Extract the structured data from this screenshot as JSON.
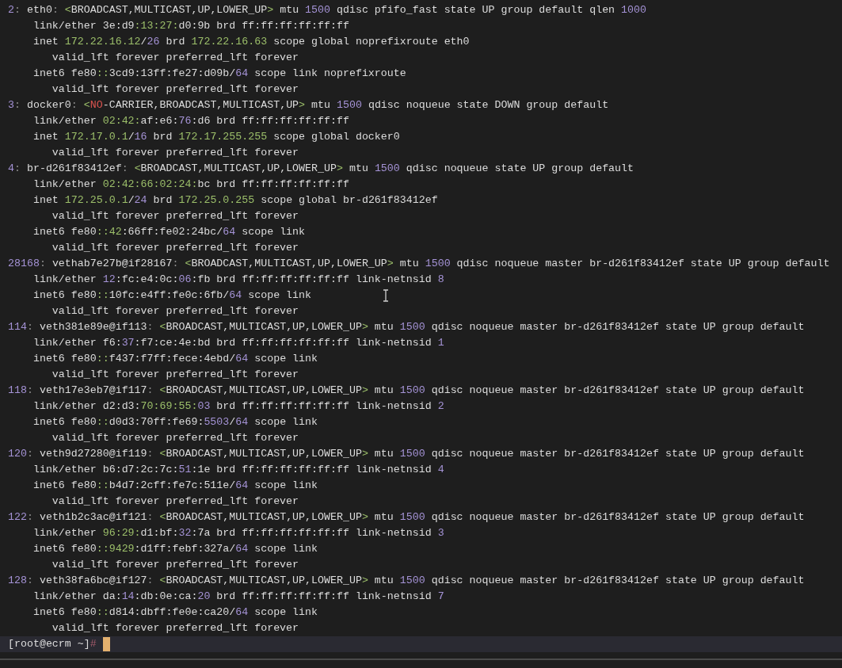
{
  "terminal": {
    "lines": [
      [
        {
          "kind": "num",
          "text": "2"
        },
        {
          "kind": "dim",
          "text": ": "
        },
        {
          "kind": "plain",
          "text": "eth0"
        },
        {
          "kind": "dim",
          "text": ": "
        },
        {
          "kind": "addr",
          "text": "<"
        },
        {
          "kind": "plain",
          "text": "BROADCAST,MULTICAST,UP,LOWER_UP"
        },
        {
          "kind": "addr",
          "text": ">"
        },
        {
          "kind": "plain",
          "text": " mtu "
        },
        {
          "kind": "num",
          "text": "1500"
        },
        {
          "kind": "plain",
          "text": " qdisc pfifo_fast state UP group default qlen "
        },
        {
          "kind": "num",
          "text": "1000"
        }
      ],
      [
        {
          "kind": "plain",
          "text": "    link/ether 3e:d9"
        },
        {
          "kind": "addr",
          "text": ":13:27:"
        },
        {
          "kind": "plain",
          "text": "d0:9b brd ff:ff:ff:ff:ff:ff"
        }
      ],
      [
        {
          "kind": "plain",
          "text": "    inet "
        },
        {
          "kind": "addr",
          "text": "172.22.16.12"
        },
        {
          "kind": "plain",
          "text": "/"
        },
        {
          "kind": "num",
          "text": "26"
        },
        {
          "kind": "plain",
          "text": " brd "
        },
        {
          "kind": "addr",
          "text": "172.22.16.63"
        },
        {
          "kind": "plain",
          "text": " scope global noprefixroute eth0"
        }
      ],
      [
        {
          "kind": "plain",
          "text": "       valid_lft forever preferred_lft forever"
        }
      ],
      [
        {
          "kind": "plain",
          "text": "    inet6 fe80"
        },
        {
          "kind": "addr",
          "text": "::"
        },
        {
          "kind": "plain",
          "text": "3cd9:13ff:fe27:d09b/"
        },
        {
          "kind": "num",
          "text": "64"
        },
        {
          "kind": "plain",
          "text": " scope link noprefixroute"
        }
      ],
      [
        {
          "kind": "plain",
          "text": "       valid_lft forever preferred_lft forever"
        }
      ],
      [
        {
          "kind": "num",
          "text": "3"
        },
        {
          "kind": "dim",
          "text": ": "
        },
        {
          "kind": "plain",
          "text": "docker0"
        },
        {
          "kind": "dim",
          "text": ": "
        },
        {
          "kind": "addr",
          "text": "<"
        },
        {
          "kind": "red",
          "text": "NO"
        },
        {
          "kind": "plain",
          "text": "-CARRIER,BROADCAST,MULTICAST,UP"
        },
        {
          "kind": "addr",
          "text": ">"
        },
        {
          "kind": "plain",
          "text": " mtu "
        },
        {
          "kind": "num",
          "text": "1500"
        },
        {
          "kind": "plain",
          "text": " qdisc noqueue state DOWN group default"
        }
      ],
      [
        {
          "kind": "plain",
          "text": "    link/ether "
        },
        {
          "kind": "addr",
          "text": "02:42:"
        },
        {
          "kind": "plain",
          "text": "af:e6:"
        },
        {
          "kind": "num",
          "text": "76"
        },
        {
          "kind": "plain",
          "text": ":d6 brd ff:ff:ff:ff:ff:ff"
        }
      ],
      [
        {
          "kind": "plain",
          "text": "    inet "
        },
        {
          "kind": "addr",
          "text": "172.17.0.1"
        },
        {
          "kind": "plain",
          "text": "/"
        },
        {
          "kind": "num",
          "text": "16"
        },
        {
          "kind": "plain",
          "text": " brd "
        },
        {
          "kind": "addr",
          "text": "172.17.255.255"
        },
        {
          "kind": "plain",
          "text": " scope global docker0"
        }
      ],
      [
        {
          "kind": "plain",
          "text": "       valid_lft forever preferred_lft forever"
        }
      ],
      [
        {
          "kind": "num",
          "text": "4"
        },
        {
          "kind": "dim",
          "text": ": "
        },
        {
          "kind": "plain",
          "text": "br-d261f83412ef"
        },
        {
          "kind": "dim",
          "text": ": "
        },
        {
          "kind": "addr",
          "text": "<"
        },
        {
          "kind": "plain",
          "text": "BROADCAST,MULTICAST,UP,LOWER_UP"
        },
        {
          "kind": "addr",
          "text": ">"
        },
        {
          "kind": "plain",
          "text": " mtu "
        },
        {
          "kind": "num",
          "text": "1500"
        },
        {
          "kind": "plain",
          "text": " qdisc noqueue state UP group default"
        }
      ],
      [
        {
          "kind": "plain",
          "text": "    link/ether "
        },
        {
          "kind": "addr",
          "text": "02:42:66:02:24:"
        },
        {
          "kind": "plain",
          "text": "bc brd ff:ff:ff:ff:ff:ff"
        }
      ],
      [
        {
          "kind": "plain",
          "text": "    inet "
        },
        {
          "kind": "addr",
          "text": "172.25.0.1"
        },
        {
          "kind": "plain",
          "text": "/"
        },
        {
          "kind": "num",
          "text": "24"
        },
        {
          "kind": "plain",
          "text": " brd "
        },
        {
          "kind": "addr",
          "text": "172.25.0.255"
        },
        {
          "kind": "plain",
          "text": " scope global br-d261f83412ef"
        }
      ],
      [
        {
          "kind": "plain",
          "text": "       valid_lft forever preferred_lft forever"
        }
      ],
      [
        {
          "kind": "plain",
          "text": "    inet6 fe80"
        },
        {
          "kind": "addr",
          "text": "::42"
        },
        {
          "kind": "plain",
          "text": ":66ff:fe02:24bc/"
        },
        {
          "kind": "num",
          "text": "64"
        },
        {
          "kind": "plain",
          "text": " scope link"
        }
      ],
      [
        {
          "kind": "plain",
          "text": "       valid_lft forever preferred_lft forever"
        }
      ],
      [
        {
          "kind": "num",
          "text": "28168"
        },
        {
          "kind": "dim",
          "text": ": "
        },
        {
          "kind": "plain",
          "text": "vethab7e27b@if28167"
        },
        {
          "kind": "dim",
          "text": ": "
        },
        {
          "kind": "addr",
          "text": "<"
        },
        {
          "kind": "plain",
          "text": "BROADCAST,MULTICAST,UP,LOWER_UP"
        },
        {
          "kind": "addr",
          "text": ">"
        },
        {
          "kind": "plain",
          "text": " mtu "
        },
        {
          "kind": "num",
          "text": "1500"
        },
        {
          "kind": "plain",
          "text": " qdisc noqueue master br-d261f83412ef state UP group default"
        }
      ],
      [
        {
          "kind": "plain",
          "text": "    link/ether "
        },
        {
          "kind": "num",
          "text": "12"
        },
        {
          "kind": "plain",
          "text": ":fc:e4:0c:"
        },
        {
          "kind": "num",
          "text": "06"
        },
        {
          "kind": "plain",
          "text": ":fb brd ff:ff:ff:ff:ff:ff link-netnsid "
        },
        {
          "kind": "num",
          "text": "8"
        }
      ],
      [
        {
          "kind": "plain",
          "text": "    inet6 fe80"
        },
        {
          "kind": "addr",
          "text": "::"
        },
        {
          "kind": "plain",
          "text": "10fc:e4ff:fe0c:6fb/"
        },
        {
          "kind": "num",
          "text": "64"
        },
        {
          "kind": "plain",
          "text": " scope link"
        }
      ],
      [
        {
          "kind": "plain",
          "text": "       valid_lft forever preferred_lft forever"
        }
      ],
      [
        {
          "kind": "num",
          "text": "114"
        },
        {
          "kind": "dim",
          "text": ": "
        },
        {
          "kind": "plain",
          "text": "veth381e89e@if113"
        },
        {
          "kind": "dim",
          "text": ": "
        },
        {
          "kind": "addr",
          "text": "<"
        },
        {
          "kind": "plain",
          "text": "BROADCAST,MULTICAST,UP,LOWER_UP"
        },
        {
          "kind": "addr",
          "text": ">"
        },
        {
          "kind": "plain",
          "text": " mtu "
        },
        {
          "kind": "num",
          "text": "1500"
        },
        {
          "kind": "plain",
          "text": " qdisc noqueue master br-d261f83412ef state UP group default"
        }
      ],
      [
        {
          "kind": "plain",
          "text": "    link/ether f6:"
        },
        {
          "kind": "num",
          "text": "37"
        },
        {
          "kind": "plain",
          "text": ":f7:ce:4e:bd brd ff:ff:ff:ff:ff:ff link-netnsid "
        },
        {
          "kind": "num",
          "text": "1"
        }
      ],
      [
        {
          "kind": "plain",
          "text": "    inet6 fe80"
        },
        {
          "kind": "addr",
          "text": "::"
        },
        {
          "kind": "plain",
          "text": "f437:f7ff:fece:4ebd/"
        },
        {
          "kind": "num",
          "text": "64"
        },
        {
          "kind": "plain",
          "text": " scope link"
        }
      ],
      [
        {
          "kind": "plain",
          "text": "       valid_lft forever preferred_lft forever"
        }
      ],
      [
        {
          "kind": "num",
          "text": "118"
        },
        {
          "kind": "dim",
          "text": ": "
        },
        {
          "kind": "plain",
          "text": "veth17e3eb7@if117"
        },
        {
          "kind": "dim",
          "text": ": "
        },
        {
          "kind": "addr",
          "text": "<"
        },
        {
          "kind": "plain",
          "text": "BROADCAST,MULTICAST,UP,LOWER_UP"
        },
        {
          "kind": "addr",
          "text": ">"
        },
        {
          "kind": "plain",
          "text": " mtu "
        },
        {
          "kind": "num",
          "text": "1500"
        },
        {
          "kind": "plain",
          "text": " qdisc noqueue master br-d261f83412ef state UP group default"
        }
      ],
      [
        {
          "kind": "plain",
          "text": "    link/ether d2:d3:"
        },
        {
          "kind": "addr",
          "text": "70:69:55:"
        },
        {
          "kind": "num",
          "text": "03"
        },
        {
          "kind": "plain",
          "text": " brd ff:ff:ff:ff:ff:ff link-netnsid "
        },
        {
          "kind": "num",
          "text": "2"
        }
      ],
      [
        {
          "kind": "plain",
          "text": "    inet6 fe80"
        },
        {
          "kind": "addr",
          "text": "::"
        },
        {
          "kind": "plain",
          "text": "d0d3:70ff:fe69:"
        },
        {
          "kind": "num",
          "text": "5503"
        },
        {
          "kind": "plain",
          "text": "/"
        },
        {
          "kind": "num",
          "text": "64"
        },
        {
          "kind": "plain",
          "text": " scope link"
        }
      ],
      [
        {
          "kind": "plain",
          "text": "       valid_lft forever preferred_lft forever"
        }
      ],
      [
        {
          "kind": "num",
          "text": "120"
        },
        {
          "kind": "dim",
          "text": ": "
        },
        {
          "kind": "plain",
          "text": "veth9d27280@if119"
        },
        {
          "kind": "dim",
          "text": ": "
        },
        {
          "kind": "addr",
          "text": "<"
        },
        {
          "kind": "plain",
          "text": "BROADCAST,MULTICAST,UP,LOWER_UP"
        },
        {
          "kind": "addr",
          "text": ">"
        },
        {
          "kind": "plain",
          "text": " mtu "
        },
        {
          "kind": "num",
          "text": "1500"
        },
        {
          "kind": "plain",
          "text": " qdisc noqueue master br-d261f83412ef state UP group default"
        }
      ],
      [
        {
          "kind": "plain",
          "text": "    link/ether b6:d7:2c:7c:"
        },
        {
          "kind": "num",
          "text": "51"
        },
        {
          "kind": "plain",
          "text": ":1e brd ff:ff:ff:ff:ff:ff link-netnsid "
        },
        {
          "kind": "num",
          "text": "4"
        }
      ],
      [
        {
          "kind": "plain",
          "text": "    inet6 fe80"
        },
        {
          "kind": "addr",
          "text": "::"
        },
        {
          "kind": "plain",
          "text": "b4d7:2cff:fe7c:511e/"
        },
        {
          "kind": "num",
          "text": "64"
        },
        {
          "kind": "plain",
          "text": " scope link"
        }
      ],
      [
        {
          "kind": "plain",
          "text": "       valid_lft forever preferred_lft forever"
        }
      ],
      [
        {
          "kind": "num",
          "text": "122"
        },
        {
          "kind": "dim",
          "text": ": "
        },
        {
          "kind": "plain",
          "text": "veth1b2c3ac@if121"
        },
        {
          "kind": "dim",
          "text": ": "
        },
        {
          "kind": "addr",
          "text": "<"
        },
        {
          "kind": "plain",
          "text": "BROADCAST,MULTICAST,UP,LOWER_UP"
        },
        {
          "kind": "addr",
          "text": ">"
        },
        {
          "kind": "plain",
          "text": " mtu "
        },
        {
          "kind": "num",
          "text": "1500"
        },
        {
          "kind": "plain",
          "text": " qdisc noqueue master br-d261f83412ef state UP group default"
        }
      ],
      [
        {
          "kind": "plain",
          "text": "    link/ether "
        },
        {
          "kind": "addr",
          "text": "96:29:"
        },
        {
          "kind": "plain",
          "text": "d1:bf:"
        },
        {
          "kind": "num",
          "text": "32"
        },
        {
          "kind": "plain",
          "text": ":7a brd ff:ff:ff:ff:ff:ff link-netnsid "
        },
        {
          "kind": "num",
          "text": "3"
        }
      ],
      [
        {
          "kind": "plain",
          "text": "    inet6 fe80"
        },
        {
          "kind": "addr",
          "text": "::9429"
        },
        {
          "kind": "plain",
          "text": ":d1ff:febf:327a/"
        },
        {
          "kind": "num",
          "text": "64"
        },
        {
          "kind": "plain",
          "text": " scope link"
        }
      ],
      [
        {
          "kind": "plain",
          "text": "       valid_lft forever preferred_lft forever"
        }
      ],
      [
        {
          "kind": "num",
          "text": "128"
        },
        {
          "kind": "dim",
          "text": ": "
        },
        {
          "kind": "plain",
          "text": "veth38fa6bc@if127"
        },
        {
          "kind": "dim",
          "text": ": "
        },
        {
          "kind": "addr",
          "text": "<"
        },
        {
          "kind": "plain",
          "text": "BROADCAST,MULTICAST,UP,LOWER_UP"
        },
        {
          "kind": "addr",
          "text": ">"
        },
        {
          "kind": "plain",
          "text": " mtu "
        },
        {
          "kind": "num",
          "text": "1500"
        },
        {
          "kind": "plain",
          "text": " qdisc noqueue master br-d261f83412ef state UP group default"
        }
      ],
      [
        {
          "kind": "plain",
          "text": "    link/ether da:"
        },
        {
          "kind": "num",
          "text": "14"
        },
        {
          "kind": "plain",
          "text": ":db:0e:ca:"
        },
        {
          "kind": "num",
          "text": "20"
        },
        {
          "kind": "plain",
          "text": " brd ff:ff:ff:ff:ff:ff link-netnsid "
        },
        {
          "kind": "num",
          "text": "7"
        }
      ],
      [
        {
          "kind": "plain",
          "text": "    inet6 fe80"
        },
        {
          "kind": "addr",
          "text": "::"
        },
        {
          "kind": "plain",
          "text": "d814:dbff:fe0e:ca20/"
        },
        {
          "kind": "num",
          "text": "64"
        },
        {
          "kind": "plain",
          "text": " scope link"
        }
      ],
      [
        {
          "kind": "plain",
          "text": "       valid_lft forever preferred_lft forever"
        }
      ]
    ],
    "prompt": [
      {
        "kind": "plain",
        "text": "[root@ecrm ~]"
      },
      {
        "kind": "hash",
        "text": "#"
      }
    ]
  }
}
